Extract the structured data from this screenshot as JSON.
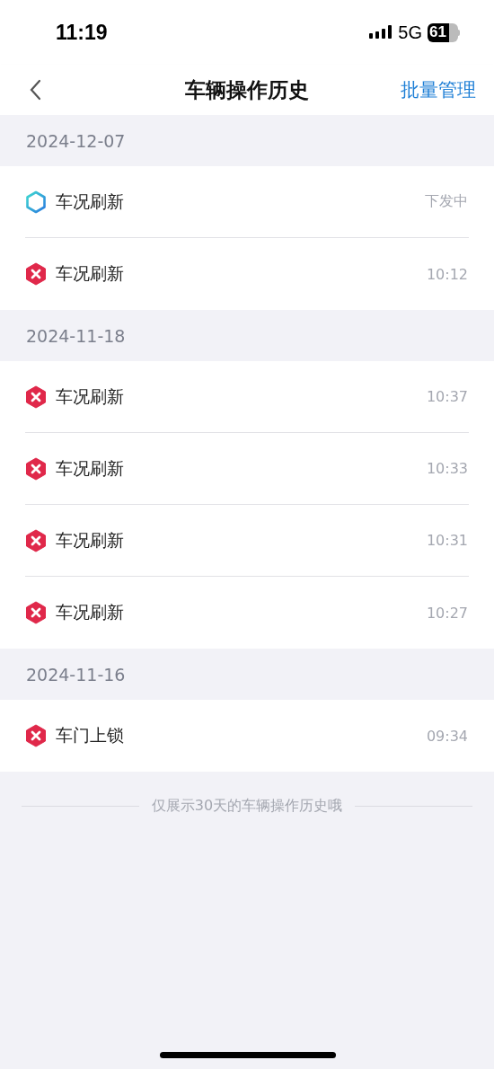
{
  "status_bar": {
    "time": "11:19",
    "network": "5G",
    "battery": "61"
  },
  "nav": {
    "title": "车辆操作历史",
    "action": "批量管理"
  },
  "groups": [
    {
      "date": "2024-12-07",
      "items": [
        {
          "label": "车况刷新",
          "kind": "pending",
          "time": "下发中"
        },
        {
          "label": "车况刷新",
          "kind": "failed",
          "time": "10:12"
        }
      ]
    },
    {
      "date": "2024-11-18",
      "items": [
        {
          "label": "车况刷新",
          "kind": "failed",
          "time": "10:37"
        },
        {
          "label": "车况刷新",
          "kind": "failed",
          "time": "10:33"
        },
        {
          "label": "车况刷新",
          "kind": "failed",
          "time": "10:31"
        },
        {
          "label": "车况刷新",
          "kind": "failed",
          "time": "10:27"
        }
      ]
    },
    {
      "date": "2024-11-16",
      "items": [
        {
          "label": "车门上锁",
          "kind": "failed",
          "time": "09:34"
        }
      ]
    }
  ],
  "footer_note": "仅展示30天的车辆操作历史哦"
}
